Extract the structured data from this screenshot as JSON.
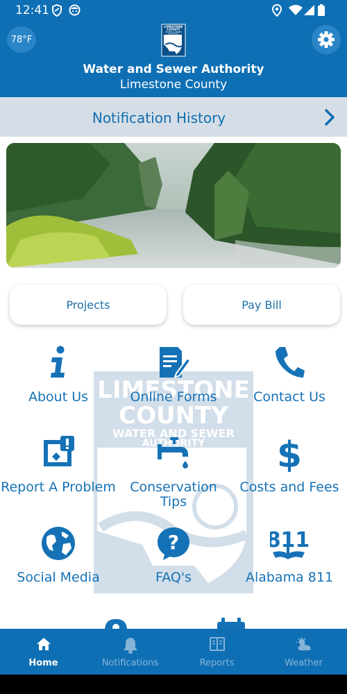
{
  "status_bar": {
    "time": "12:41",
    "left_icons": [
      "shield-icon",
      "face-icon"
    ],
    "right_icons": [
      "location-icon",
      "wifi-icon",
      "signal-icon",
      "battery-icon"
    ]
  },
  "header": {
    "temperature": "78°F",
    "title": "Water and Sewer Authority",
    "subtitle": "Limestone County",
    "logo_text": [
      "LIMESTONE",
      "COUNTY",
      "WATER & SEWER",
      "AUTHORITY"
    ]
  },
  "notification_history": {
    "label": "Notification History"
  },
  "buttons": {
    "projects": "Projects",
    "pay_bill": "Pay Bill"
  },
  "watermark_text": [
    "LIMESTONE",
    "COUNTY",
    "WATER AND SEWER",
    "AUTHORITY"
  ],
  "tiles": [
    {
      "label": "About Us",
      "icon": "info-icon"
    },
    {
      "label": "Online Forms",
      "icon": "form-icon"
    },
    {
      "label": "Contact Us",
      "icon": "phone-icon"
    },
    {
      "label": "Report A Problem",
      "icon": "report-icon"
    },
    {
      "label": "Conservation Tips",
      "icon": "faucet-icon"
    },
    {
      "label": "Costs and Fees",
      "icon": "dollar-icon"
    },
    {
      "label": "Social Media",
      "icon": "globe-icon"
    },
    {
      "label": "FAQ's",
      "icon": "question-icon"
    },
    {
      "label": "Alabama 811",
      "icon": "811-icon",
      "icon_text": "811"
    }
  ],
  "bottom_nav": [
    {
      "label": "Home",
      "icon": "home-icon",
      "active": true
    },
    {
      "label": "Notifications",
      "icon": "bell-icon",
      "active": false
    },
    {
      "label": "Reports",
      "icon": "reports-icon",
      "active": false
    },
    {
      "label": "Weather",
      "icon": "weather-icon",
      "active": false
    }
  ],
  "colors": {
    "brand_blue": "#0e6fb4",
    "accent_blue": "#1572b6",
    "notification_bar": "#d5dee6",
    "nav_inactive": "#86b4d8"
  }
}
